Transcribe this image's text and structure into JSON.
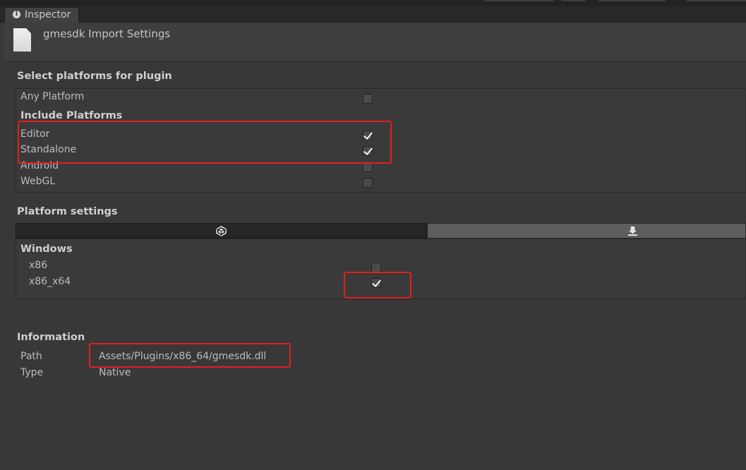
{
  "window": {
    "tab_label": "Inspector"
  },
  "header": {
    "title": "gmesdk Import Settings"
  },
  "select_platforms": {
    "title": "Select platforms for plugin",
    "any_platform": {
      "label": "Any Platform",
      "checked": false
    },
    "include_title": "Include Platforms",
    "platforms": [
      {
        "label": "Editor",
        "checked": true
      },
      {
        "label": "Standalone",
        "checked": true
      },
      {
        "label": "Android",
        "checked": false
      },
      {
        "label": "WebGL",
        "checked": false
      }
    ]
  },
  "platform_settings": {
    "title": "Platform settings",
    "tabs": [
      {
        "icon": "unity-logo-icon",
        "selected": true
      },
      {
        "icon": "download-icon",
        "selected": false
      }
    ],
    "windows_title": "Windows",
    "archs": [
      {
        "label": "x86",
        "checked": false
      },
      {
        "label": "x86_x64",
        "checked": true
      }
    ]
  },
  "information": {
    "title": "Information",
    "path_label": "Path",
    "path_value": "Assets/Plugins/x86_64/gmesdk.dll",
    "type_label": "Type",
    "type_value": "Native"
  },
  "colors": {
    "highlight": "#e0201e",
    "background": "#383838"
  }
}
